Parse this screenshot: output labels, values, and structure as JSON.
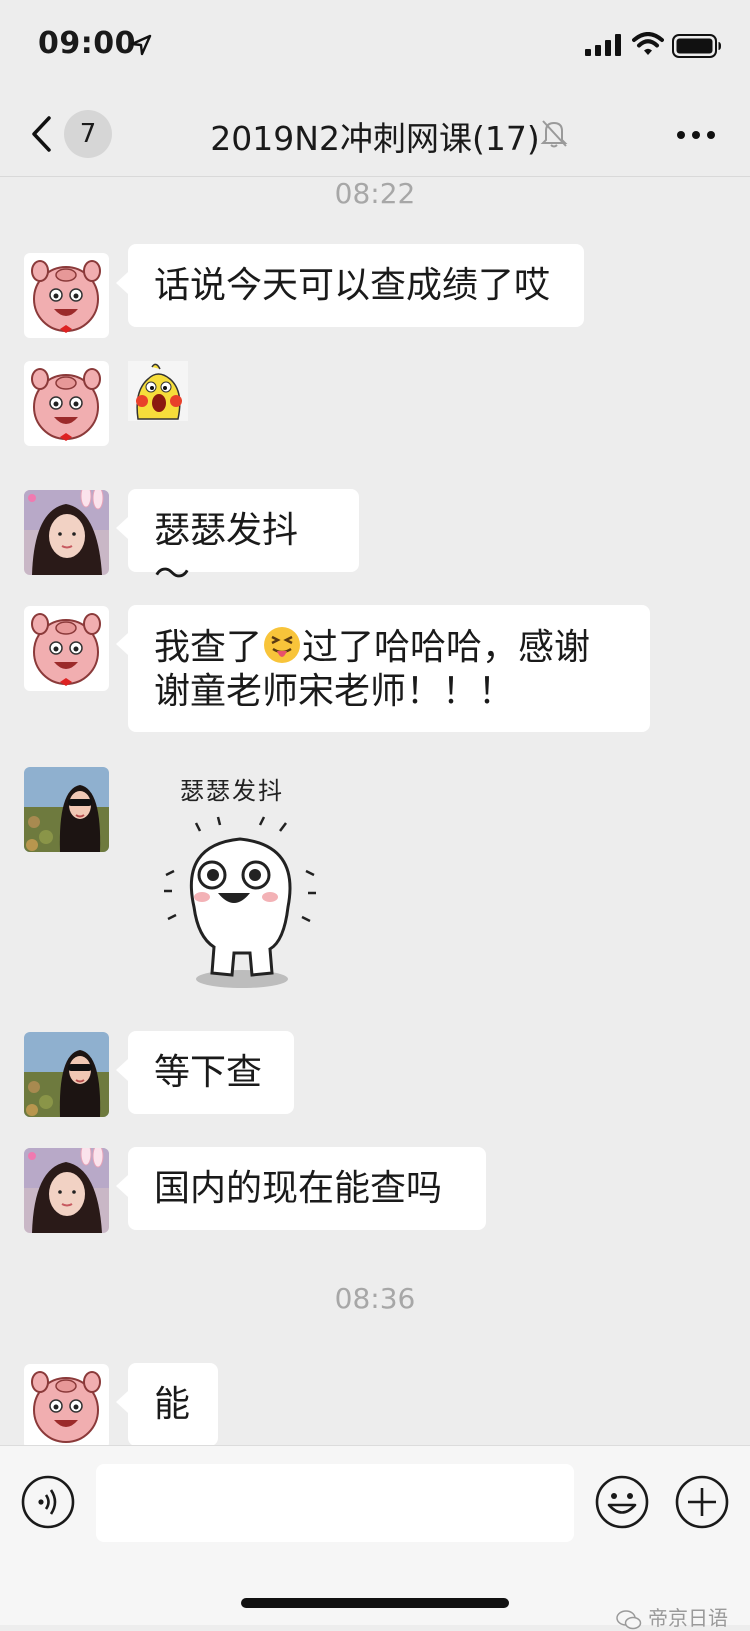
{
  "status_bar": {
    "time": "09:00"
  },
  "nav": {
    "back_count": "7",
    "title": "2019N2冲刺网课(17)"
  },
  "messages": {
    "ts1": "08:22",
    "m1": "话说今天可以查成绩了哎",
    "m3": "瑟瑟发抖～",
    "m4": "我查了😝过了哈哈哈，感谢谢童老师宋老师！！！",
    "m4_line1": "我查了",
    "m4_line1b": "过了哈哈哈，感谢",
    "m4_line2": "谢童老师宋老师！！！",
    "sticker_caption": "瑟瑟发抖",
    "m6": "等下查",
    "m7": "国内的现在能查吗",
    "ts2": "08:36",
    "m8": "能"
  },
  "input": {
    "placeholder": ""
  },
  "watermark": "帝京日语",
  "colors": {
    "background": "#ededed",
    "bubble": "#ffffff",
    "timestamp": "#a7a7a7"
  },
  "icons": [
    "location-arrow-icon",
    "signal-icon",
    "wifi-icon",
    "battery-icon",
    "back-chevron-icon",
    "mute-bell-icon",
    "more-icon",
    "voice-icon",
    "emoji-icon",
    "plus-icon"
  ]
}
